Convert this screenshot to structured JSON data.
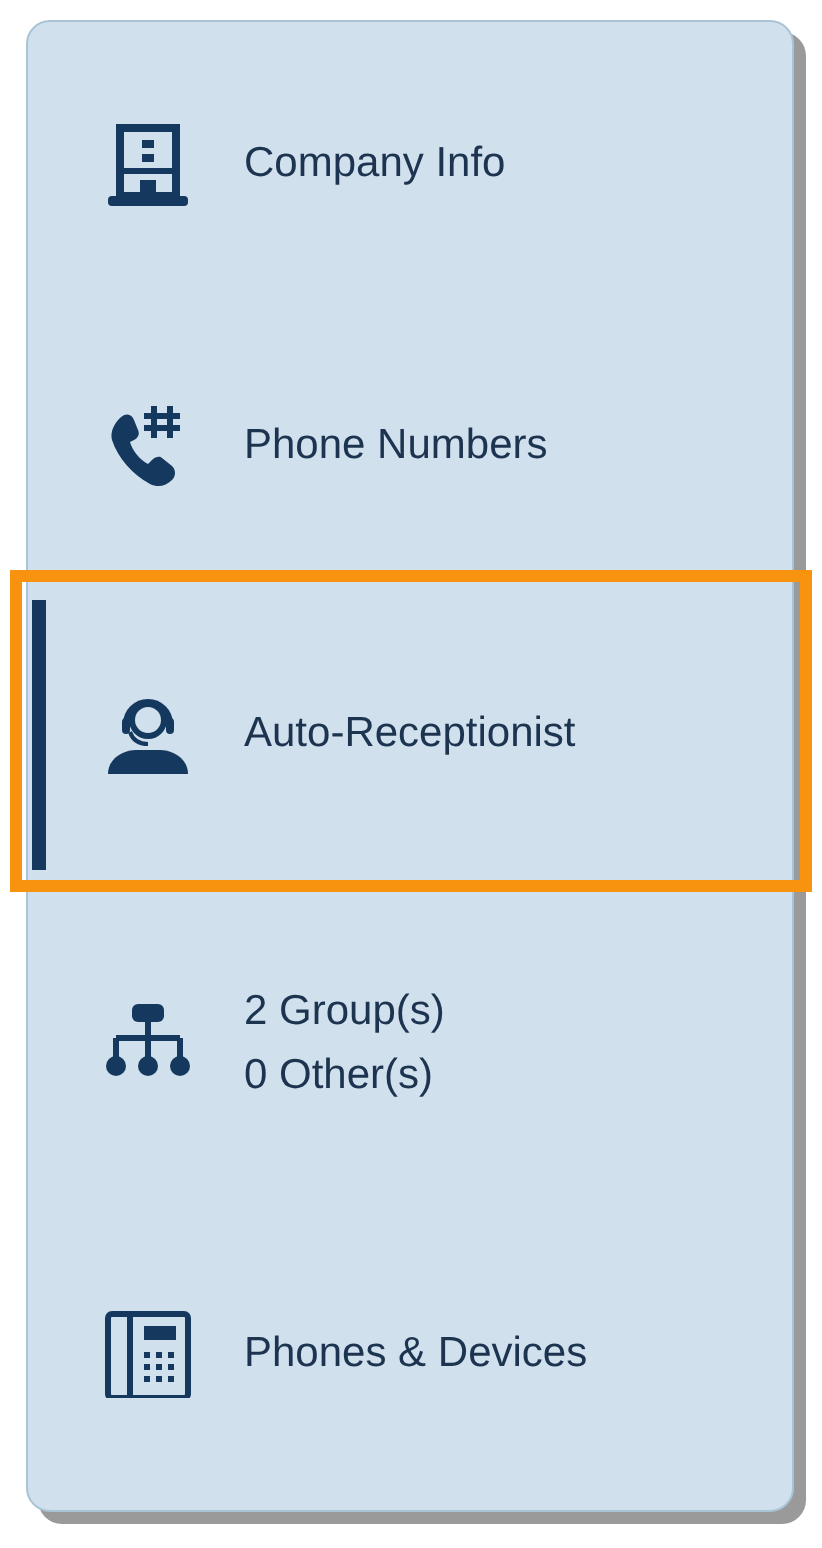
{
  "nav_items": [
    {
      "kind": "building",
      "lines": [
        "Company Info"
      ],
      "selected": false,
      "highlighted": false
    },
    {
      "kind": "phone-hash",
      "lines": [
        "Phone Numbers"
      ],
      "selected": false,
      "highlighted": false
    },
    {
      "kind": "headset",
      "lines": [
        "Auto-Receptionist"
      ],
      "selected": true,
      "highlighted": true
    },
    {
      "kind": "org",
      "lines": [
        "2 Group(s)",
        "0 Other(s)"
      ],
      "selected": false,
      "highlighted": false
    },
    {
      "kind": "desk-phone",
      "lines": [
        "Phones & Devices"
      ],
      "selected": false,
      "highlighted": false
    }
  ]
}
